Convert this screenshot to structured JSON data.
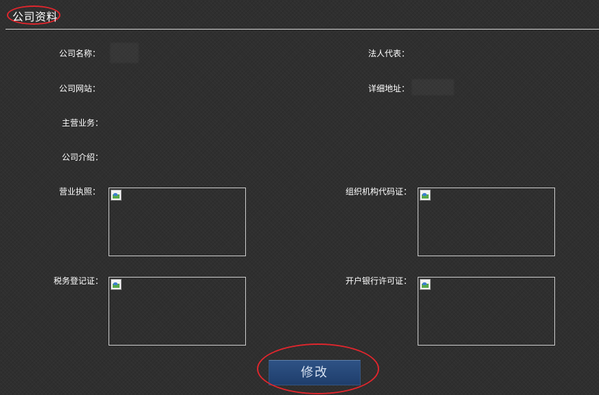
{
  "page": {
    "title": "公司资料"
  },
  "fields": {
    "company_name": {
      "label": "公司名称：",
      "value": ""
    },
    "legal_rep": {
      "label": "法人代表：",
      "value": ""
    },
    "company_website": {
      "label": "公司网站：",
      "value": ""
    },
    "address": {
      "label": "详细地址：",
      "value": ""
    },
    "main_business": {
      "label": "主营业务：",
      "value": ""
    },
    "company_intro": {
      "label": "公司介绍：",
      "value": ""
    }
  },
  "documents": {
    "business_license": {
      "label": "营业执照："
    },
    "org_code_cert": {
      "label": "组织机构代码证："
    },
    "tax_reg_cert": {
      "label": "税务登记证："
    },
    "bank_permit": {
      "label": "开户银行许可证："
    }
  },
  "actions": {
    "edit_label": "修改"
  },
  "colors": {
    "background": "#2f2f2f",
    "text": "#ffffff",
    "divider": "#d6d6d6",
    "annotation_ring": "#e0262d",
    "button_bg": "#2a4a7a",
    "button_text": "#d8e3f2"
  },
  "icons": {
    "image_placeholder": "broken-image-icon"
  }
}
